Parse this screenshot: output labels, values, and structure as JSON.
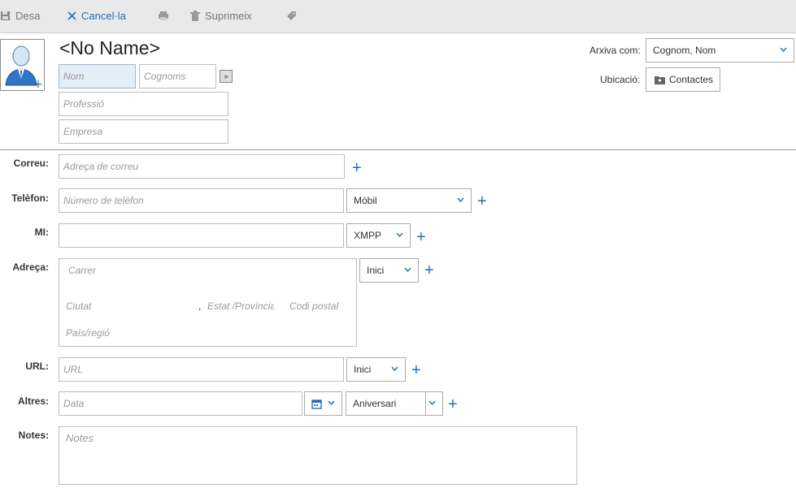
{
  "toolbar": {
    "save": "Desa",
    "cancel": "Cancel·la",
    "delete": "Suprimeix"
  },
  "header": {
    "name_title": "<No Name>",
    "first_name_placeholder": "Nom",
    "last_name_placeholder": "Cognoms",
    "expand_label": "»",
    "job_placeholder": "Professió",
    "company_placeholder": "Empresa",
    "file_as_label": "Arxiva com:",
    "file_as_value": "Cognom, Nom",
    "location_label": "Ubicació:",
    "location_value": "Contactes"
  },
  "rows": {
    "email_label": "Correu:",
    "email_placeholder": "Adreça de correu",
    "phone_label": "Telèfon:",
    "phone_placeholder": "Número de telèfon",
    "phone_type": "Mòbil",
    "im_label": "MI:",
    "im_type": "XMPP",
    "address_label": "Adreça:",
    "address_type": "Inici",
    "street_placeholder": "Carrer",
    "city_placeholder": "Ciutat",
    "comma": ",",
    "state_placeholder": "Estat /Província",
    "postal_placeholder": "Codi postal",
    "country_placeholder": "País/regió",
    "url_label": "URL:",
    "url_placeholder": "URL",
    "url_type": "Inici",
    "other_label": "Altres:",
    "date_placeholder": "Data",
    "other_type": "Aniversari",
    "notes_label": "Notes:",
    "notes_placeholder": "Notes",
    "plus": "+"
  },
  "colors": {
    "accent": "#1f6fbf",
    "toolbar_bg": "#e9e9e9"
  }
}
